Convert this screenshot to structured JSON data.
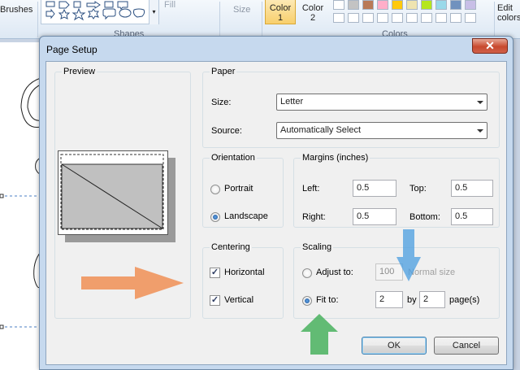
{
  "ribbon": {
    "brushes_label": "Brushes",
    "fill_label": "Fill",
    "shapes_group": "Shapes",
    "size_label": "Size",
    "color1_line1": "Color",
    "color1_line2": "1",
    "color2_line1": "Color",
    "color2_line2": "2",
    "colors_group": "Colors",
    "edit_line1": "Edit",
    "edit_line2": "colors",
    "palette": [
      "#ffffff",
      "#c3c3c3",
      "#b97a57",
      "#ffaec9",
      "#ffc90e",
      "#efe4b0",
      "#b5e61d",
      "#99d9ea",
      "#7092be",
      "#c8bfe7"
    ]
  },
  "dialog": {
    "title": "Page Setup",
    "close_glyph": "✕",
    "preview": {
      "title": "Preview"
    },
    "paper": {
      "title": "Paper",
      "size_label": "Size:",
      "size_value": "Letter",
      "source_label": "Source:",
      "source_value": "Automatically Select"
    },
    "orientation": {
      "title": "Orientation",
      "portrait": "Portrait",
      "landscape": "Landscape",
      "selected": "landscape"
    },
    "margins": {
      "title": "Margins (inches)",
      "left_label": "Left:",
      "left_value": "0.5",
      "top_label": "Top:",
      "top_value": "0.5",
      "right_label": "Right:",
      "right_value": "0.5",
      "bottom_label": "Bottom:",
      "bottom_value": "0.5"
    },
    "centering": {
      "title": "Centering",
      "horizontal": "Horizontal",
      "vertical": "Vertical",
      "check_glyph": "✓"
    },
    "scaling": {
      "title": "Scaling",
      "adjust_label": "Adjust to:",
      "adjust_value": "100",
      "normal_size": "Normal size",
      "fit_label": "Fit to:",
      "fit_pages_wide": "2",
      "by_label": "by",
      "fit_pages_tall": "2",
      "pages_label": "page(s)"
    },
    "ok_label": "OK",
    "cancel_label": "Cancel"
  },
  "annotations": {
    "orange_arrow_color": "#f08a4b",
    "blue_arrow_color": "#4a9ee0",
    "green_arrow_color": "#3fae55"
  }
}
